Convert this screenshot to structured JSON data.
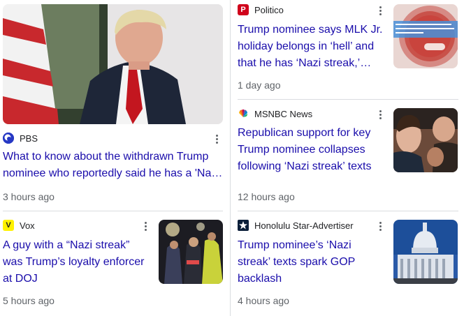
{
  "cards": [
    {
      "source": "PBS",
      "logo_text": "",
      "logo_color": "#2638c4",
      "headline": "What to know about the withdrawn Trump nominee who reportedly said he has a 'Na…",
      "time": "3 hours ago"
    },
    {
      "source": "Politico",
      "logo_text": "P",
      "logo_color": "#d0021b",
      "headline": "Trump nominee says MLK Jr. holiday belongs in ‘hell’ and that he has ‘Nazi streak,’…",
      "time": "1 day ago"
    },
    {
      "source": "MSNBC News",
      "logo_text": "",
      "logo_color": "#ffffff",
      "headline": "Republican support for key Trump nominee collapses following ‘Nazi streak’ texts",
      "time": "12 hours ago"
    },
    {
      "source": "Vox",
      "logo_text": "V",
      "logo_color": "#fff200",
      "headline": "A guy with a “Nazi streak” was Trump’s loyalty enforcer at DOJ",
      "time": "5 hours ago"
    },
    {
      "source": "Honolulu Star-Advertiser",
      "logo_text": "",
      "logo_color": "#0b1f3a",
      "headline": "Trump nominee’s ‘Nazi streak’ texts spark GOP backlash",
      "time": "4 hours ago"
    }
  ],
  "colors": {
    "headline_link": "#1a0dab",
    "meta_text": "#5f6368",
    "divider": "#dadce0"
  },
  "icons": {
    "more": "more-vert-icon"
  }
}
